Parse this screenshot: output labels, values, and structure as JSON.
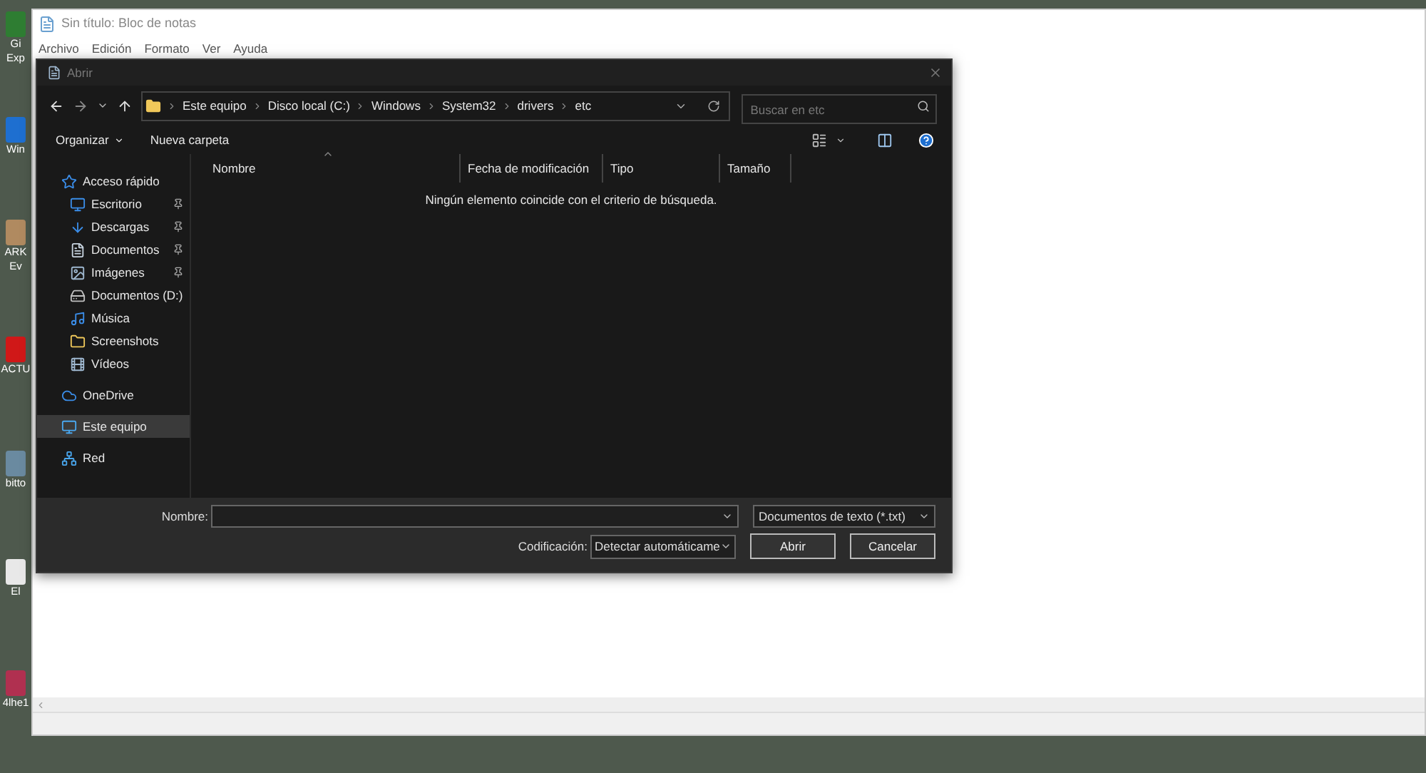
{
  "desktop": {
    "icons": [
      {
        "lines": [
          "Gi",
          "Exp"
        ],
        "color": "#2e7d32"
      },
      {
        "lines": [
          "Win"
        ],
        "color": "#1e6fd0"
      },
      {
        "lines": [
          "ARK",
          "Ev"
        ],
        "color": "#b08a60"
      },
      {
        "lines": [
          "ACTU"
        ],
        "color": "#d01818"
      },
      {
        "lines": [
          "bitto"
        ],
        "color": "#6a8aa0"
      },
      {
        "lines": [
          "El"
        ],
        "color": "#e8e8e8"
      },
      {
        "lines": [
          "4lhe1"
        ],
        "color": "#b03050"
      }
    ]
  },
  "notepad": {
    "title": "Sin título: Bloc de notas",
    "menu": [
      "Archivo",
      "Edición",
      "Formato",
      "Ver",
      "Ayuda"
    ]
  },
  "dialog": {
    "title": "Abrir",
    "breadcrumb": [
      "Este equipo",
      "Disco local (C:)",
      "Windows",
      "System32",
      "drivers",
      "etc"
    ],
    "search": {
      "placeholder": "Buscar en etc"
    },
    "toolbar": {
      "organize": "Organizar",
      "new_folder": "Nueva carpeta"
    },
    "sidebar": [
      {
        "label": "Acceso rápido",
        "kind": "quick",
        "selected": false,
        "children": [
          {
            "label": "Escritorio",
            "kind": "desktop",
            "pinned": true,
            "selected": false
          },
          {
            "label": "Descargas",
            "kind": "download",
            "pinned": true,
            "selected": false
          },
          {
            "label": "Documentos",
            "kind": "document",
            "pinned": true,
            "selected": false
          },
          {
            "label": "Imágenes",
            "kind": "images",
            "pinned": true,
            "selected": false
          },
          {
            "label": "Documentos (D:)",
            "kind": "drive",
            "pinned": false,
            "selected": false
          },
          {
            "label": "Música",
            "kind": "music",
            "pinned": false,
            "selected": false
          },
          {
            "label": "Screenshots",
            "kind": "folder",
            "pinned": false,
            "selected": false
          },
          {
            "label": "Vídeos",
            "kind": "video",
            "pinned": false,
            "selected": false
          }
        ]
      },
      {
        "label": "OneDrive",
        "kind": "cloud",
        "selected": false
      },
      {
        "label": "Este equipo",
        "kind": "pc",
        "selected": true
      },
      {
        "label": "Red",
        "kind": "network",
        "selected": false
      }
    ],
    "columns": [
      "Nombre",
      "Fecha de modificación",
      "Tipo",
      "Tamaño"
    ],
    "empty_message": "Ningún elemento coincide con el criterio de búsqueda.",
    "footer": {
      "name_label": "Nombre:",
      "file_type": "Documentos de texto (*.txt)",
      "encoding_label": "Codificación:",
      "encoding": "Detectar automáticame",
      "buttons": [
        "Abrir",
        "Cancelar"
      ]
    }
  }
}
